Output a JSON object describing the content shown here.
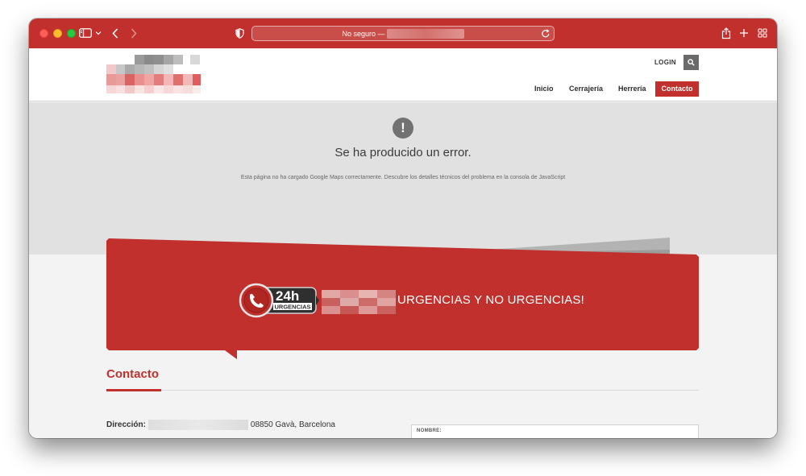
{
  "browser": {
    "address_label": "No seguro —",
    "colors": {
      "toolbar": "#c1302c"
    },
    "icons": [
      "sidebar-icon",
      "chevron-down-icon",
      "back-icon",
      "forward-icon",
      "shield-icon",
      "reload-icon",
      "share-icon",
      "plus-icon",
      "tabs-grid-icon"
    ]
  },
  "header": {
    "login_label": "LOGIN",
    "search_icon": "search-icon",
    "nav": [
      {
        "label": "Inicio",
        "active": false
      },
      {
        "label": "Cerrajería",
        "active": false
      },
      {
        "label": "Herrería",
        "active": false
      },
      {
        "label": "Contacto",
        "active": true
      }
    ]
  },
  "map_error": {
    "icon": "exclamation-icon",
    "title": "Se ha producido un error.",
    "description": "Esta página no ha cargado Google Maps correctamente. Descubre los detalles técnicos del problema en la consola de JavaScript"
  },
  "banner": {
    "badge_big": "24h",
    "badge_small": "URGENCIAS",
    "text": "URGENCIAS Y NO URGENCIAS!",
    "colors": {
      "accent": "#c1302c"
    }
  },
  "contact": {
    "title": "Contacto",
    "address_label": "Dirección:",
    "address_value": "08850 Gavà, Barcelona",
    "form_name_label": "NOMBRE:"
  }
}
